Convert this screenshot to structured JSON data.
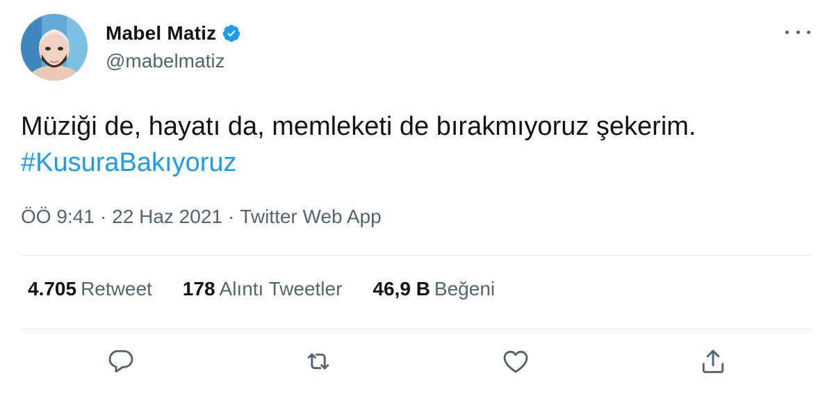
{
  "author": {
    "display_name": "Mabel Matiz",
    "handle": "@mabelmatiz",
    "verified": true,
    "avatar_icon": "avatar-illustration",
    "verified_color": "#1d9bf0"
  },
  "more_icon": "more-horizontal-icon",
  "tweet": {
    "text_line1": "Müziği de, hayatı da, memleketi de bırakmıyoruz şekerim.",
    "hashtag": "#KusuraBakıyoruz",
    "hashtag_color": "#1d9bf0"
  },
  "meta": {
    "time": "ÖÖ 9:41",
    "date": "22 Haz 2021",
    "source": "Twitter Web App",
    "separator": "·"
  },
  "stats": {
    "retweets_count": "4.705",
    "retweets_label": "Retweet",
    "quotes_count": "178",
    "quotes_label": "Alıntı Tweetler",
    "likes_count": "46,9 B",
    "likes_label": "Beğeni"
  },
  "actions": [
    {
      "name": "reply-icon"
    },
    {
      "name": "retweet-icon"
    },
    {
      "name": "like-icon"
    },
    {
      "name": "share-icon"
    }
  ]
}
